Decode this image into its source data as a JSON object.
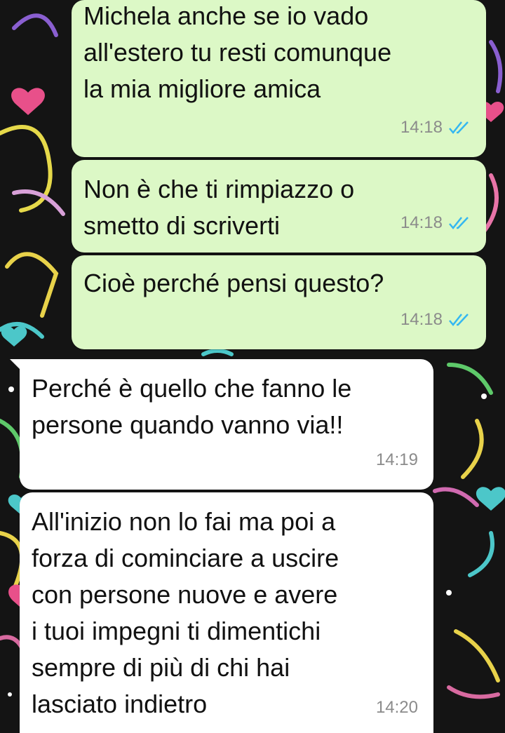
{
  "chat": {
    "messages": [
      {
        "text": "Michela anche se io vado\nall'estero tu resti comunque\nla mia migliore amica",
        "time": "14:18",
        "direction": "outgoing",
        "status": "read"
      },
      {
        "text": "Non è che ti rimpiazzo o\nsmetto di scriverti",
        "time": "14:18",
        "direction": "outgoing",
        "status": "read"
      },
      {
        "text": "Cioè perché pensi questo?",
        "time": "14:18",
        "direction": "outgoing",
        "status": "read"
      },
      {
        "text": "Perché è quello che fanno le\npersone quando vanno via!!",
        "time": "14:19",
        "direction": "incoming"
      },
      {
        "text": "All'inizio non lo fai ma poi a\nforza di cominciare a uscire\ncon persone nuove e avere\ni tuoi impegni ti dimentichi\nsempre di più di chi hai\nlasciato indietro",
        "time": "14:20",
        "direction": "incoming"
      }
    ]
  },
  "icons": {
    "read_receipt": "double-check-icon",
    "wallpaper": "hearts-pattern"
  },
  "colors": {
    "outgoing_bubble": "#dcf8c6",
    "incoming_bubble": "#ffffff",
    "read_tick": "#34b7f1",
    "timestamp": "#8b8b8b",
    "wallpaper_bg": "#141414"
  }
}
